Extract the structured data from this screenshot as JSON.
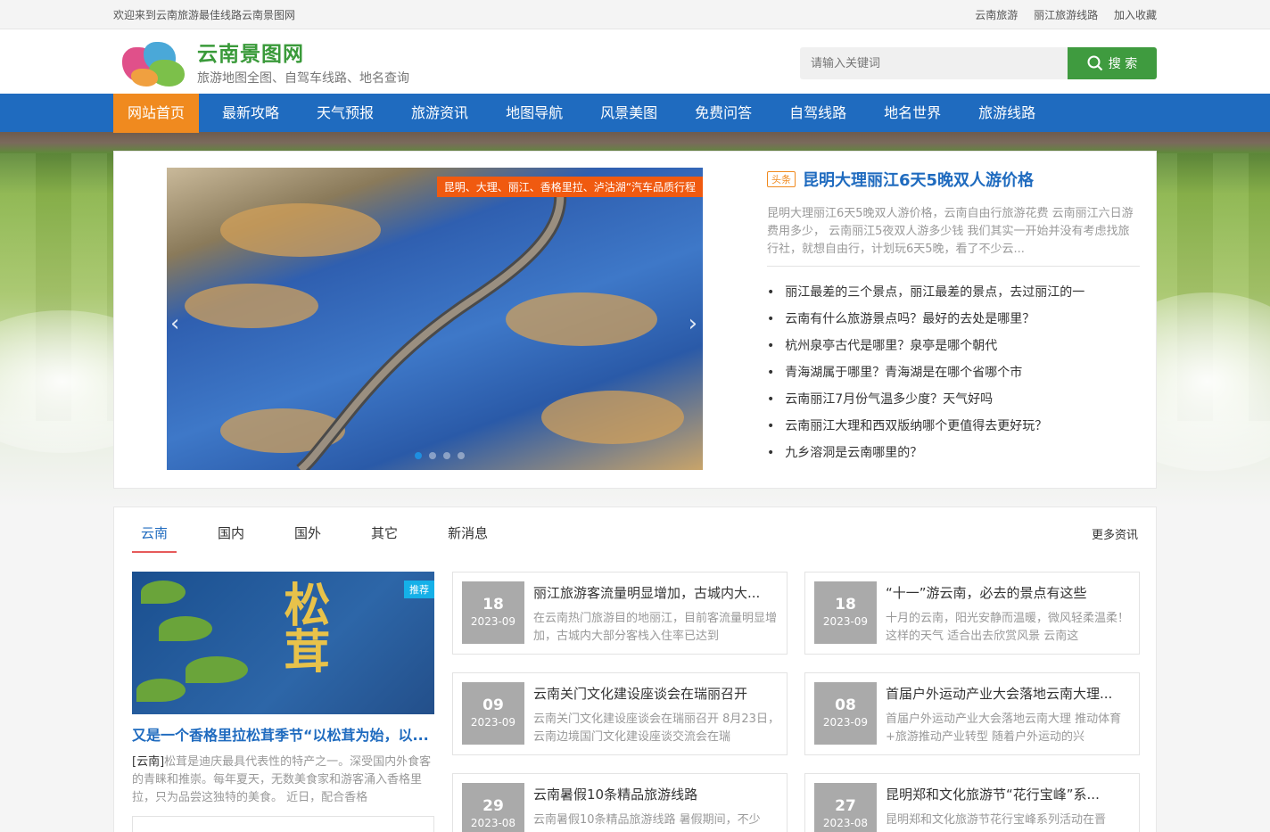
{
  "topbar": {
    "welcome": "欢迎来到云南旅游最佳线路云南景图网",
    "links": [
      "云南旅游",
      "丽江旅游线路",
      "加入收藏"
    ]
  },
  "header": {
    "site_name": "云南景图网",
    "tagline": "旅游地图全图、自驾车线路、地名查询",
    "search_placeholder": "请输入关键词",
    "search_button": "搜 索"
  },
  "nav": [
    "网站首页",
    "最新攻略",
    "天气预报",
    "旅游资讯",
    "地图导航",
    "风景美图",
    "免费问答",
    "自驾线路",
    "地名世界",
    "旅游线路"
  ],
  "slider": {
    "caption": "昆明、大理、丽江、香格里拉、泸沽湖“汽车品质行程",
    "prev": "‹",
    "next": "›"
  },
  "headline": {
    "tag": "头条",
    "title": "昆明大理丽江6天5晚双人游价格",
    "desc": "昆明大理丽江6天5晚双人游价格，云南自由行旅游花费 云南丽江六日游费用多少， 云南丽江5夜双人游多少钱 我们其实一开始并没有考虑找旅行社，就想自由行，计划玩6天5晚，看了不少云...",
    "list": [
      "丽江最差的三个景点，丽江最差的景点，去过丽江的一",
      "云南有什么旅游景点吗？最好的去处是哪里？",
      "杭州泉亭古代是哪里？泉亭是哪个朝代",
      "青海湖属于哪里？青海湖是在哪个省哪个市",
      "云南丽江7月份气温多少度？天气好吗",
      "云南丽江大理和西双版纳哪个更值得去更好玩？",
      "九乡溶洞是云南哪里的？"
    ]
  },
  "news": {
    "tabs": [
      "云南",
      "国内",
      "国外",
      "其它",
      "新消息"
    ],
    "more": "更多资讯",
    "featured": {
      "badge": "推荐",
      "image_text": "松茸",
      "title": "又是一个香格里拉松茸季节“以松茸为始，以...",
      "category": "[云南]",
      "desc": "松茸是迪庆最具代表性的特产之一。深受国内外食客的青睐和推崇。每年夏天，无数美食家和游客涌入香格里拉，只为品尝这独特的美食。 近日，配合香格"
    },
    "cards": [
      {
        "day": "18",
        "month": "2023-09",
        "title": "丽江旅游客流量明显增加，古城内大...",
        "summary": "在云南热门旅游目的地丽江，目前客流量明显增加，古城内大部分客栈入住率已达到"
      },
      {
        "day": "18",
        "month": "2023-09",
        "title": "“十一”游云南，必去的景点有这些",
        "summary": "十月的云南，阳光安静而温暖，微风轻柔温柔！ 这样的天气 适合出去欣赏风景 云南这"
      },
      {
        "day": "09",
        "month": "2023-09",
        "title": "云南关门文化建设座谈会在瑞丽召开",
        "summary": "云南关门文化建设座谈会在瑞丽召开 8月23日，云南边境国门文化建设座谈交流会在瑞"
      },
      {
        "day": "08",
        "month": "2023-09",
        "title": "首届户外运动产业大会落地云南大理...",
        "summary": "首届户外运动产业大会落地云南大理 推动体育+旅游推动产业转型 随着户外运动的兴"
      },
      {
        "day": "29",
        "month": "2023-08",
        "title": "云南暑假10条精品旅游线路",
        "summary": "云南暑假10条精品旅游线路 暑假期间，不少"
      },
      {
        "day": "27",
        "month": "2023-08",
        "title": "昆明郑和文化旅游节“花行宝峰”系...",
        "summary": "昆明郑和文化旅游节花行宝峰系列活动在晋"
      }
    ]
  },
  "colors": {
    "nav_bg": "#1f6bbf",
    "nav_active": "#f08a1f",
    "brand_green": "#3a9a3a",
    "link_blue": "#1f6bbf"
  }
}
